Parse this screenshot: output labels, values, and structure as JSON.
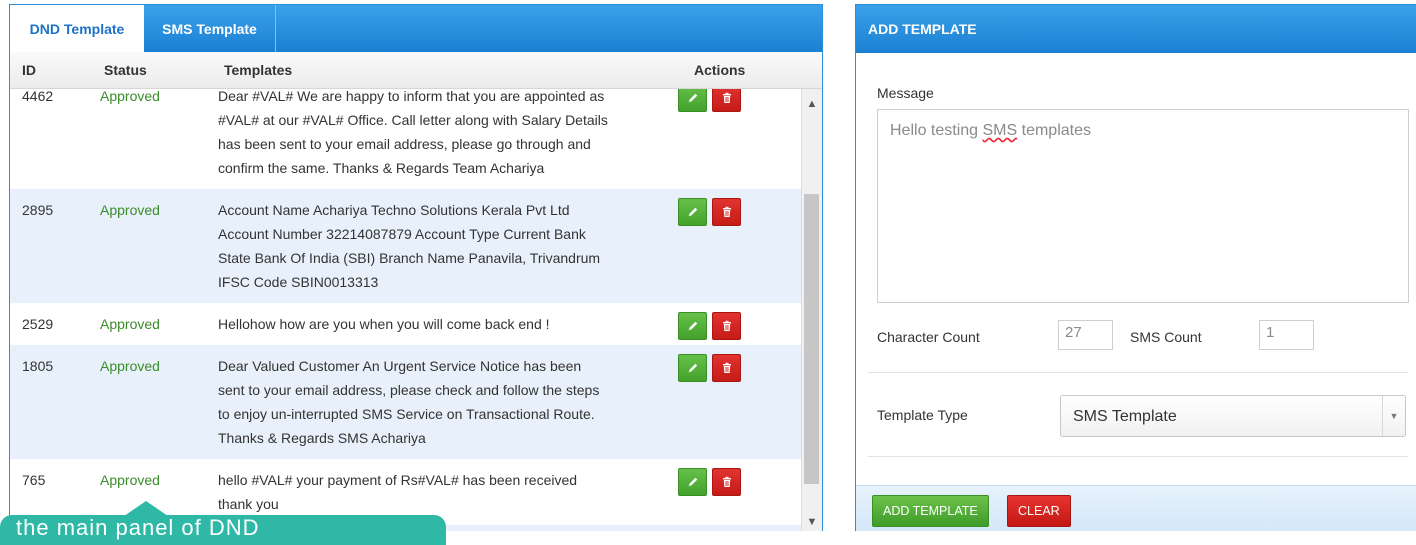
{
  "tabs": [
    {
      "label": "DND Template",
      "active": true
    },
    {
      "label": "SMS Template",
      "active": false
    }
  ],
  "table": {
    "headers": {
      "id": "ID",
      "status": "Status",
      "templates": "Templates",
      "actions": "Actions"
    },
    "rows": [
      {
        "id": "4462",
        "status": "Approved",
        "lines": [
          "Dear #VAL# We are happy to inform that you are appointed as",
          "#VAL# at our #VAL# Office. Call letter along with Salary Details",
          "has been sent to your email address, please go through and",
          "confirm the same. Thanks & Regards Team Achariya"
        ]
      },
      {
        "id": "2895",
        "status": "Approved",
        "lines": [
          "Account Name Achariya Techno Solutions Kerala Pvt Ltd",
          "Account Number 32214087879 Account Type Current Bank",
          "State Bank Of India (SBI) Branch Name Panavila, Trivandrum",
          "IFSC Code SBIN0013313"
        ]
      },
      {
        "id": "2529",
        "status": "Approved",
        "lines": [
          "Hellohow how are you when you will come back end !"
        ]
      },
      {
        "id": "1805",
        "status": "Approved",
        "lines": [
          "Dear Valued Customer An Urgent Service Notice has been",
          "sent to your email address, please check and follow the steps",
          "to enjoy un-interrupted SMS Service on Transactional Route.",
          "Thanks & Regards SMS Achariya"
        ]
      },
      {
        "id": "765",
        "status": "Approved",
        "lines": [
          "hello #VAL# your payment of Rs#VAL# has been received",
          "thank you"
        ]
      },
      {
        "id": "",
        "status": "",
        "lines": [
          ""
        ]
      }
    ]
  },
  "tooltip": {
    "text": "the main panel of DND"
  },
  "add_panel": {
    "title": "ADD TEMPLATE",
    "message_label": "Message",
    "message_pre": "Hello testing ",
    "message_sq": "SMS",
    "message_post": " templates",
    "char_count_label": "Character Count",
    "char_count": "27",
    "sms_count_label": "SMS Count",
    "sms_count": "1",
    "template_type_label": "Template Type",
    "template_type_value": "SMS Template",
    "add_button": "ADD TEMPLATE",
    "clear_button": "CLEAR"
  },
  "colors": {
    "primary": "#1c80d2",
    "approved": "#3b8c2a",
    "edit": "#43a22c",
    "delete": "#c51b17",
    "tooltip": "#2fb8a6"
  }
}
